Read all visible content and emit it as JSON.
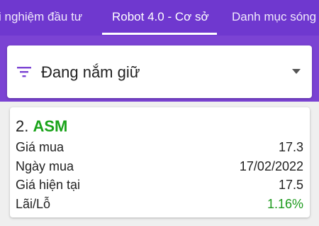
{
  "tabs": [
    {
      "label": "i nghiệm đầu tư",
      "active": false
    },
    {
      "label": "Robot 4.0 - Cơ sở",
      "active": true
    },
    {
      "label": "Danh mục sóng",
      "active": false
    }
  ],
  "filter": {
    "icon": "filter-icon",
    "selected": "Đang nắm giữ",
    "dropdown_icon": "chevron-down-icon"
  },
  "holding": {
    "index": "2.",
    "symbol": "ASM",
    "rows": [
      {
        "label": "Giá mua",
        "value": "17.3"
      },
      {
        "label": "Ngày mua",
        "value": "17/02/2022"
      },
      {
        "label": "Giá hiện tại",
        "value": "17.5"
      },
      {
        "label": "Lãi/Lỗ",
        "value": "1.16%"
      }
    ]
  },
  "colors": {
    "header": "#6f38cf",
    "accent": "#7b43d3",
    "symbol": "#1aa31a",
    "gain": "#1c9a1c",
    "content_bg": "#efefef"
  }
}
